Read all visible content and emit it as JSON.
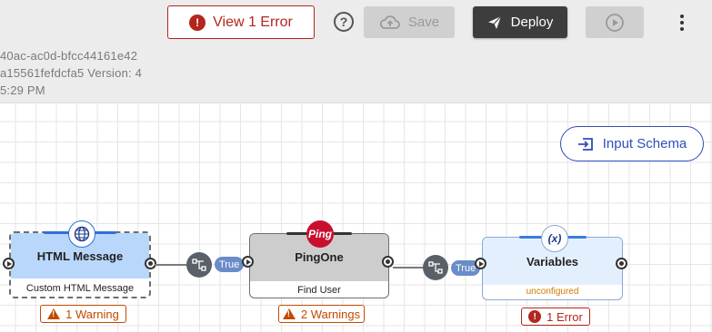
{
  "header": {
    "meta": {
      "line1": "40ac-ac0d-bfcc44161e42",
      "line2": "a15561fefdcfa5  Version: 4",
      "line3": "5:29 PM"
    },
    "error_button_label": "View 1 Error",
    "help_icon": "?",
    "save_label": "Save",
    "deploy_label": "Deploy"
  },
  "canvas": {
    "input_schema_label": "Input Schema",
    "nodes": {
      "html_message": {
        "title": "HTML Message",
        "subtitle": "Custom HTML Message",
        "status": "1 Warning",
        "icon": "globe-icon"
      },
      "pingone": {
        "title": "PingOne",
        "subtitle": "Find User",
        "status": "2 Warnings",
        "logo_text": "Ping"
      },
      "variables": {
        "title": "Variables",
        "subtitle": "unconfigured",
        "status": "1 Error",
        "icon_text": "(x)"
      }
    },
    "connectors": [
      {
        "label": "True"
      },
      {
        "label": "True"
      }
    ]
  },
  "colors": {
    "error": "#b3261e",
    "warning": "#c24a00",
    "accent": "#2f4fb8",
    "ping_red": "#c8102e"
  }
}
